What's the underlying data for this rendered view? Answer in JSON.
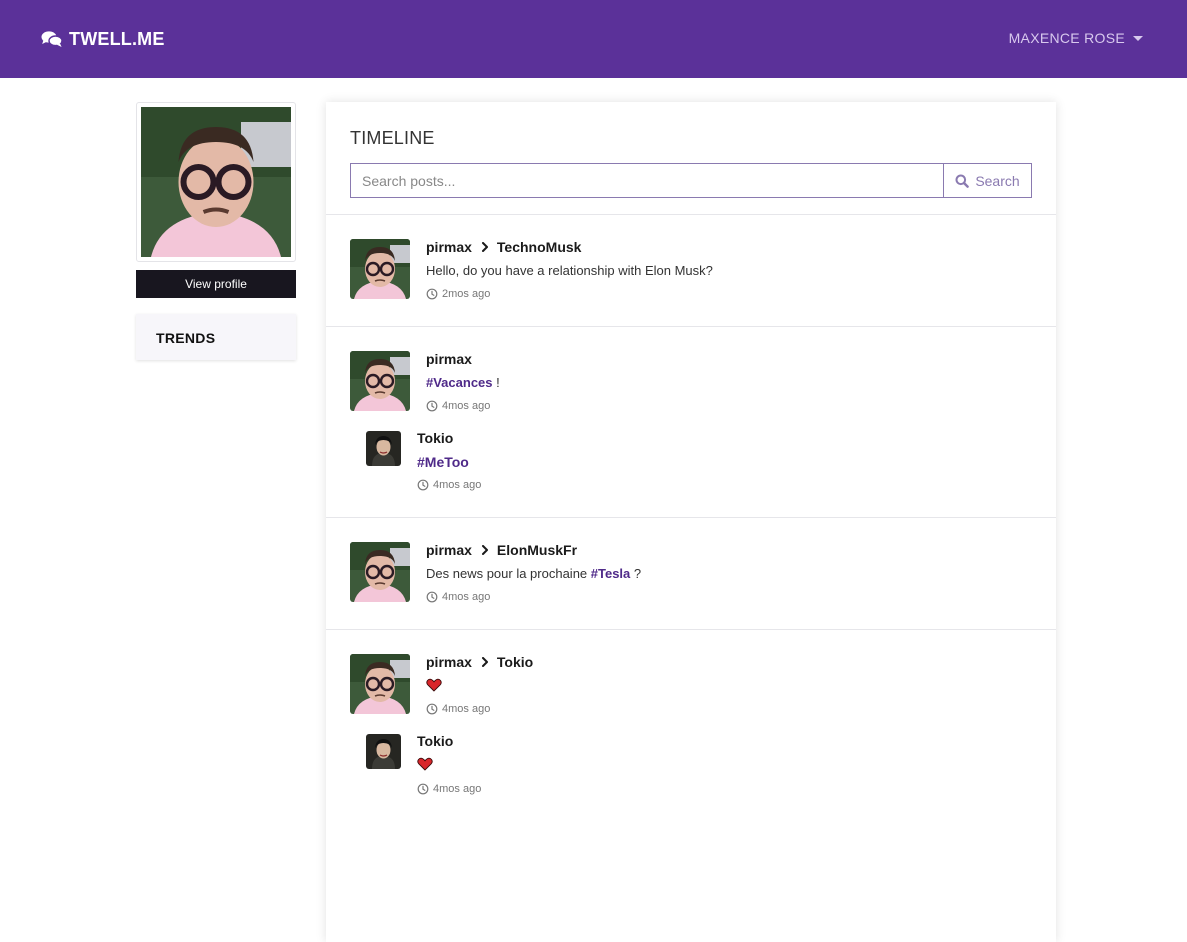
{
  "navbar": {
    "brand": "TWELL.ME",
    "user": "MAXENCE ROSE"
  },
  "sidebar": {
    "view_profile": "View profile",
    "trends_title": "TRENDS"
  },
  "timeline": {
    "title": "TIMELINE",
    "search_placeholder": "Search posts...",
    "search_label": "Search"
  },
  "posts": [
    {
      "author": "pirmax",
      "recipient": "TechnoMusk",
      "text": "Hello, do you have a relationship with Elon Musk?",
      "time": "2mos ago"
    },
    {
      "author": "pirmax",
      "hashtag": "#Vacances",
      "text_after": " !",
      "time": "4mos ago",
      "reply": {
        "author": "Tokio",
        "hashtag": "#MeToo",
        "time": "4mos ago"
      }
    },
    {
      "author": "pirmax",
      "recipient": "ElonMuskFr",
      "text_before": "Des news pour la prochaine ",
      "hashtag": "#Tesla",
      "text_after": " ?",
      "time": "4mos ago"
    },
    {
      "author": "pirmax",
      "recipient": "Tokio",
      "time": "4mos ago",
      "reply": {
        "author": "Tokio",
        "time": "4mos ago"
      }
    }
  ],
  "colors": {
    "brand": "#5b3199",
    "hashtag": "#4f2a89",
    "heart": "#d9262b"
  }
}
